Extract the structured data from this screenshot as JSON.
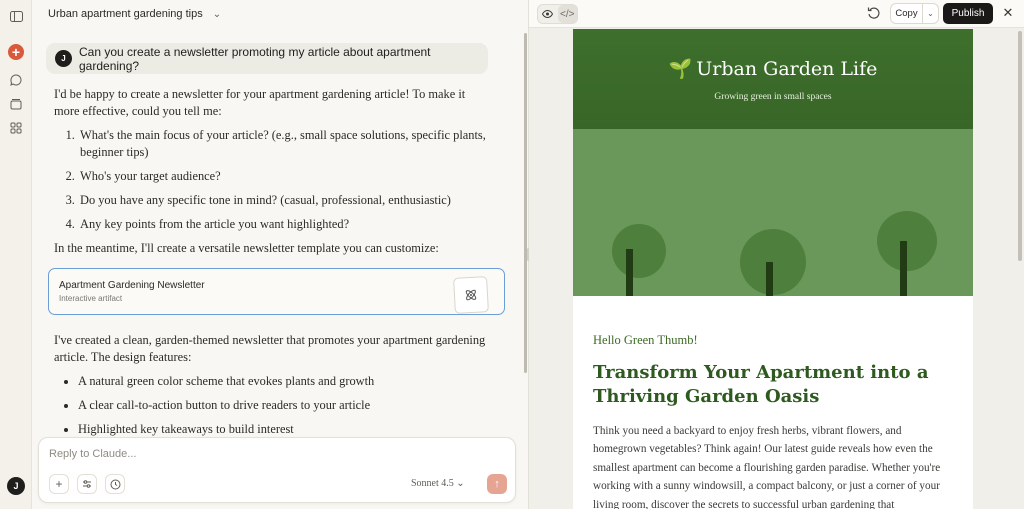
{
  "sidebar": {
    "icons": [
      "sidebar-toggle-icon",
      "new-chat-icon",
      "chats-icon",
      "projects-icon",
      "artifacts-icon"
    ],
    "user_initial": "J",
    "accent": "#d9593d"
  },
  "chat": {
    "title": "Urban apartment gardening tips",
    "user_initial": "J",
    "user_message": "Can you create a newsletter promoting my article about apartment gardening?",
    "reply_intro": "I'd be happy to create a newsletter for your apartment gardening article! To make it more effective, could you tell me:",
    "questions": [
      "What's the main focus of your article? (e.g., small space solutions, specific plants, beginner tips)",
      "Who's your target audience?",
      "Do you have any specific tone in mind? (casual, professional, enthusiastic)",
      "Any key points from the article you want highlighted?"
    ],
    "reply_meantime": "In the meantime, I'll create a versatile newsletter template you can customize:",
    "artifact": {
      "title": "Apartment Gardening Newsletter",
      "subtitle": "Interactive artifact"
    },
    "reply_after": "I've created a clean, garden-themed newsletter that promotes your apartment gardening article. The design features:",
    "features": [
      "A natural green color scheme that evokes plants and growth",
      "A clear call-to-action button to drive readers to your article",
      "Highlighted key takeaways to build interest"
    ]
  },
  "composer": {
    "placeholder": "Reply to Claude...",
    "model": "Sonnet 4.5",
    "send_color": "#e6a592"
  },
  "artifact_pane": {
    "copy_label": "Copy",
    "publish_label": "Publish"
  },
  "newsletter": {
    "title": "Urban Garden Life",
    "tagline": "Growing green in small spaces",
    "header_color": "#3c6b2b",
    "hero_color": "#6a985a",
    "greeting": "Hello Green Thumb!",
    "headline": "Transform Your Apartment into a Thriving Garden Oasis",
    "body": "Think you need a backyard to enjoy fresh herbs, vibrant flowers, and homegrown vegetables? Think again! Our latest guide reveals how even the smallest apartment can become a flourishing garden paradise. Whether you're working with a sunny windowsill, a compact balcony, or just a corner of your living room, discover the secrets to successful urban gardening that"
  }
}
